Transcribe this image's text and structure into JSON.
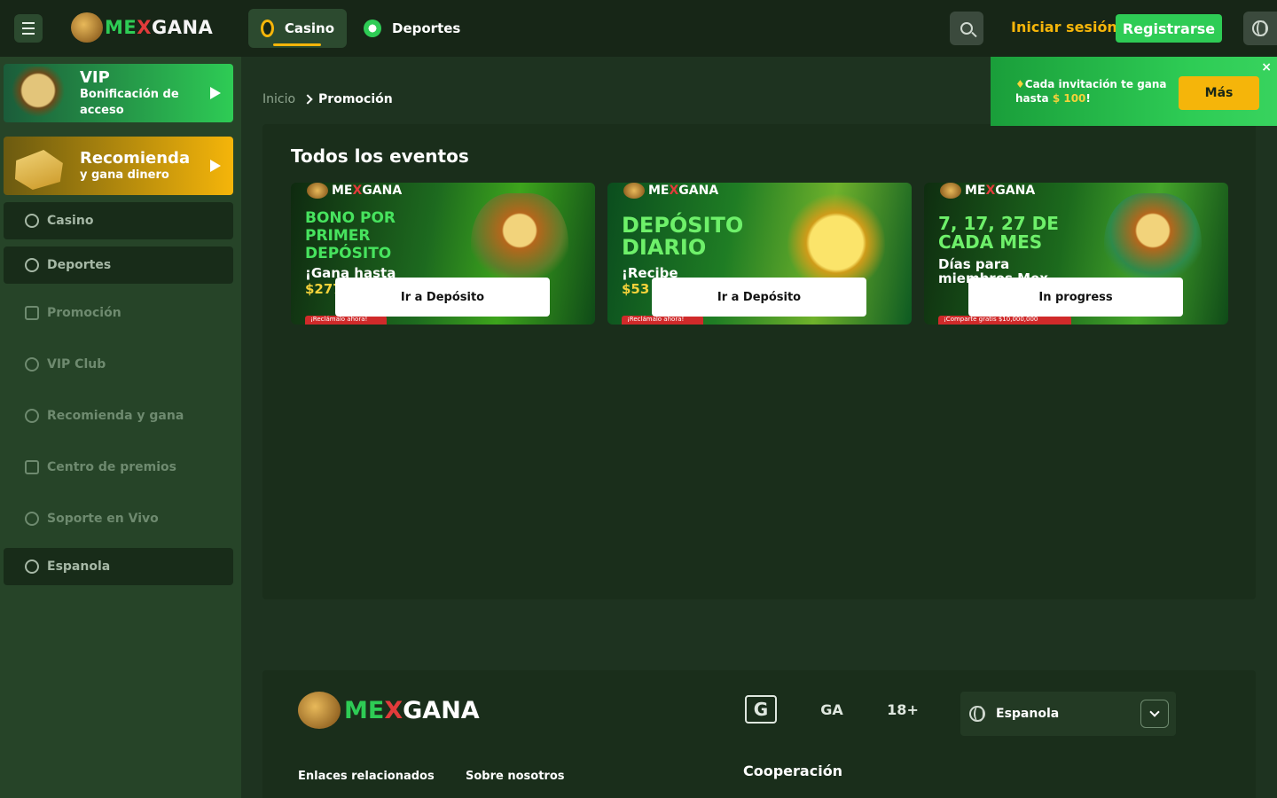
{
  "header": {
    "logo": {
      "me": "ME",
      "x": "X",
      "gana": "GANA"
    },
    "tabs": [
      {
        "label": "Casino",
        "active": true
      },
      {
        "label": "Deportes",
        "active": false
      }
    ],
    "login_label": "Iniciar sesión",
    "register_label": "Registrarse"
  },
  "sidebar": {
    "promo_vip": {
      "title": "VIP",
      "subtitle": "Bonificación de acceso"
    },
    "promo_referral": {
      "title": "Recomienda",
      "subtitle": "y gana dinero"
    },
    "buttons": {
      "casino": "Casino",
      "deportes": "Deportes",
      "language": "Espanola"
    },
    "items": {
      "promocion": "Promoción",
      "vip_club": "VIP Club",
      "recomienda": "Recomienda y gana",
      "centro": "Centro de premios",
      "soporte": "Soporte en Vivo"
    }
  },
  "breadcrumb": {
    "home": "Inicio",
    "current": "Promoción"
  },
  "main": {
    "title": "Todos los eventos",
    "cards": [
      {
        "headline": "BONO POR PRIMER DEPÓSITO",
        "sub": "¡Gana hasta",
        "amount": "$277",
        "ribbon": "¡Reclámalo ahora!",
        "button": "Ir a Depósito"
      },
      {
        "headline": "DEPÓSITO DIARIO",
        "sub": "¡Recibe",
        "amount": "$53",
        "ribbon": "¡Reclámalo ahora!",
        "button": "Ir a Depósito"
      },
      {
        "headline": "7, 17, 27 DE CADA MES",
        "sub": "Días para miembros Mex",
        "amount": "",
        "ribbon": "¡Comparte gratis $10,000,000",
        "button": "In progress"
      }
    ]
  },
  "toast": {
    "text": "Cada invitación te gana hasta",
    "amount": "$ 100",
    "suffix": "!",
    "button": "Más",
    "close": "×"
  },
  "footer": {
    "logo": {
      "me": "ME",
      "x": "X",
      "gana": "GANA"
    },
    "age_badge": "18+",
    "language": "Espanola",
    "links": {
      "related": "Enlaces relacionados",
      "about": "Sobre nosotros"
    },
    "cooperation": "Cooperación"
  },
  "colors": {
    "brand_green": "#2ecc55",
    "accent_gold": "#f5b50a",
    "brand_red": "#e23b3b",
    "bg": "#1e3320"
  },
  "icons": [
    "menu-icon",
    "casino-chip-icon",
    "soccer-ball-icon",
    "search-icon",
    "globe-icon",
    "play-icon",
    "chevron-right-icon",
    "chevron-down-icon",
    "close-icon"
  ]
}
